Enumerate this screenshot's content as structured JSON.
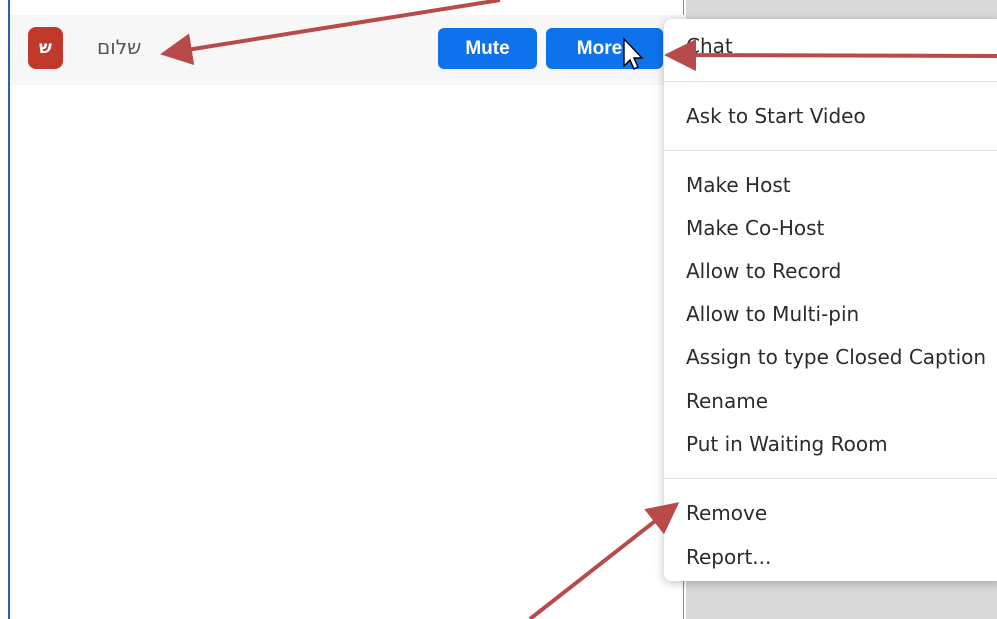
{
  "participant": {
    "avatar_letter": "ש",
    "name": "שלום"
  },
  "buttons": {
    "mute": "Mute",
    "more": "More",
    "more_chevron": "›"
  },
  "menu": {
    "chat": "Chat",
    "ask_start_video": "Ask to Start Video",
    "make_host": "Make Host",
    "make_cohost": "Make Co-Host",
    "allow_record": "Allow to Record",
    "allow_multipin": "Allow to Multi-pin",
    "assign_cc": "Assign to type Closed Caption",
    "rename": "Rename",
    "waiting_room": "Put in Waiting Room",
    "remove": "Remove",
    "report": "Report..."
  },
  "colors": {
    "button_blue": "#0e72ed",
    "avatar_red": "#c0392b",
    "arrow_red": "#b84a4a"
  }
}
